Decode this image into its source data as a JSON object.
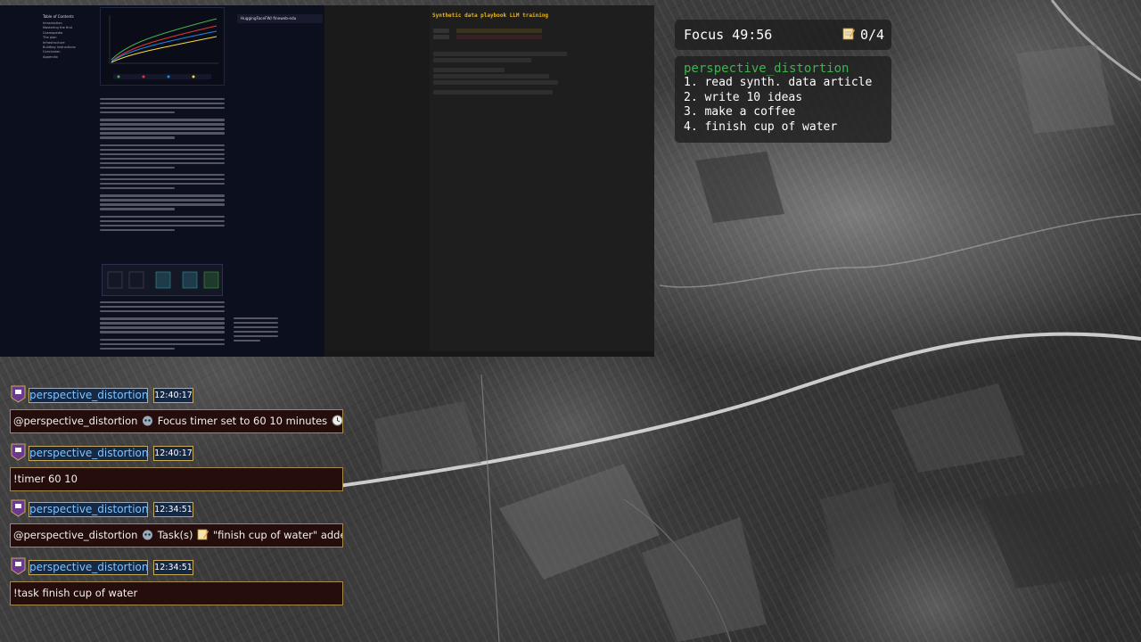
{
  "focus": {
    "timer": "Focus 49:56",
    "count": "0/4",
    "icon": "memo-icon"
  },
  "task_list": {
    "user": "perspective_distortion",
    "tasks": [
      "1. read synth. data article",
      "2. write 10 ideas",
      "3. make a coffee",
      "4. finish cup of water"
    ]
  },
  "chat": [
    {
      "username": "perspective_distortion",
      "time": "12:40:17",
      "parts": [
        "@perspective_distortion",
        "Focus timer set to 60 10 minutes"
      ],
      "icons": [
        "bot-icon",
        "clock-icon"
      ]
    },
    {
      "username": "perspective_distortion",
      "time": "12:40:17",
      "parts": [
        "!timer 60 10"
      ],
      "icons": []
    },
    {
      "username": "perspective_distortion",
      "time": "12:34:51",
      "parts": [
        "@perspective_distortion",
        "Task(s)",
        "\"finish cup of water\" added!"
      ],
      "icons": [
        "bot-icon",
        "memo-icon"
      ]
    },
    {
      "username": "perspective_distortion",
      "time": "12:34:51",
      "parts": [
        "!task finish cup of water"
      ],
      "icons": []
    }
  ],
  "shared_screen": {
    "doc": {
      "toc_title": "Table of Contents",
      "toc_items": [
        "Introduction",
        "Mastering the first",
        "Cosmopedia",
        "The plan",
        "Infrastructure",
        "Building instructions",
        "Conclusion",
        "Appendix"
      ],
      "bookmark": "HuggingFaceFW/ fineweb-edu"
    },
    "ide": {
      "title": "Synthetic data playbook LLM training"
    }
  },
  "colors": {
    "accent_green": "#3fb24f",
    "chat_name": "#7fc3ff",
    "chat_border": "#c8a85a",
    "chat_bg": "#240d0b",
    "badge": "#6b3a8f"
  }
}
